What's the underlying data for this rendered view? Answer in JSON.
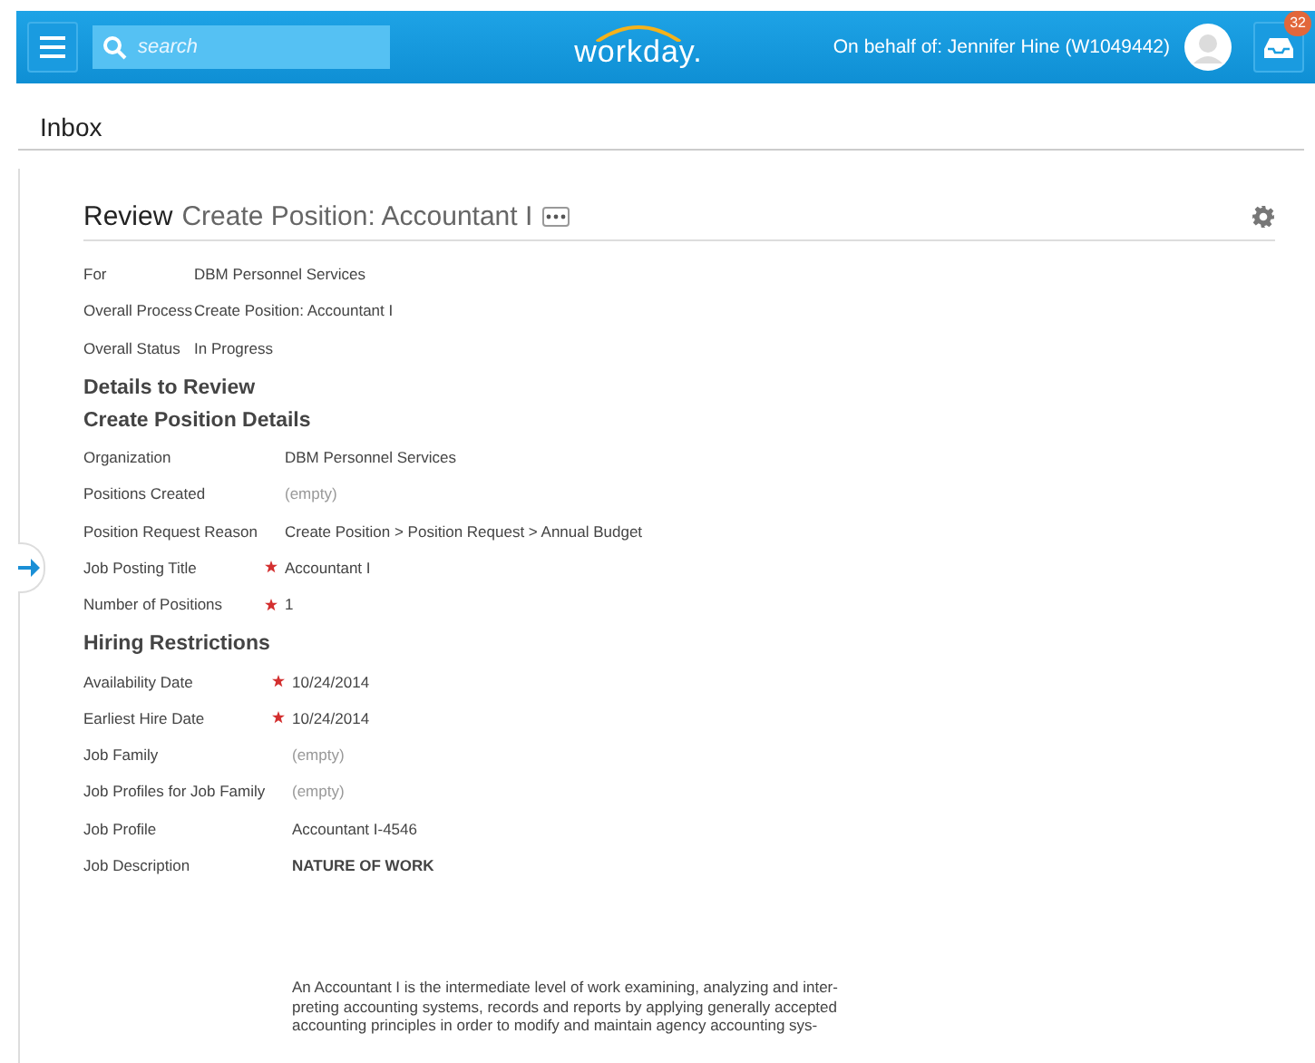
{
  "header": {
    "search": {
      "placeholder": "search"
    },
    "logo": "workday.",
    "on_behalf": "On behalf of: Jennifer Hine (W1049442)",
    "notifications": "32"
  },
  "page_title": "Inbox",
  "review": {
    "label": "Review",
    "title": "Create Position: Accountant I",
    "summary": [
      {
        "label": "For",
        "value": "DBM Personnel Services",
        "required": false,
        "empty": false
      },
      {
        "label": "Overall Process",
        "value": "Create Position: Accountant I",
        "required": false,
        "empty": false
      },
      {
        "label": "Overall Status",
        "value": "In Progress",
        "required": false,
        "empty": false
      }
    ],
    "section_title": "Details to Review",
    "groups": [
      {
        "title": "Create Position Details",
        "fields": [
          {
            "label": "Organization",
            "value": "DBM Personnel Services",
            "required": false,
            "empty": false
          },
          {
            "label": "Positions Created",
            "value": "(empty)",
            "required": false,
            "empty": true
          },
          {
            "label": "Position Request Reason",
            "value": "Create Position > Position Request > Annual Budget",
            "required": false,
            "empty": false
          },
          {
            "label": "Job Posting Title",
            "value": "Accountant I",
            "required": true,
            "empty": false
          },
          {
            "label": "Number of Positions",
            "value": "1",
            "required": true,
            "empty": false
          }
        ]
      },
      {
        "title": "Hiring Restrictions",
        "fields": [
          {
            "label": "Availability Date",
            "value": "10/24/2014",
            "required": true,
            "empty": false
          },
          {
            "label": "Earliest Hire Date",
            "value": "10/24/2014",
            "required": true,
            "empty": false
          },
          {
            "label": "Job Family",
            "value": "(empty)",
            "required": false,
            "empty": true
          },
          {
            "label": "Job Profiles for Job Family",
            "value": "(empty)",
            "required": false,
            "empty": true
          },
          {
            "label": "Job Profile",
            "value": "Accountant I-4546",
            "required": false,
            "empty": false
          }
        ]
      }
    ],
    "description": {
      "label": "Job Description",
      "heading": "NATURE OF WORK",
      "lines": [
        "An Accountant I is the intermediate level of work examining, analyzing and inter-",
        "preting accounting systems, records and reports by applying generally accepted",
        "accounting principles in order to modify and maintain agency accounting sys-"
      ]
    }
  }
}
